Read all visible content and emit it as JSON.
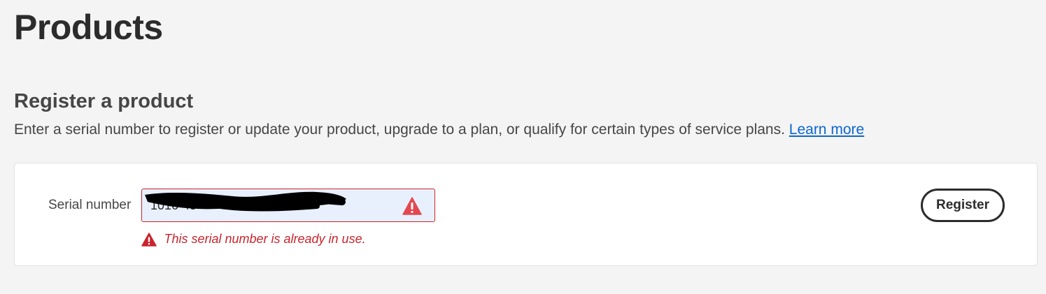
{
  "page": {
    "title": "Products"
  },
  "register_section": {
    "heading": "Register a product",
    "description": "Enter a serial number to register or update your product, upgrade to a plan, or qualify for certain types of service plans.",
    "learn_more_label": "Learn more"
  },
  "form": {
    "serial_label": "Serial number",
    "serial_value": "1016-45",
    "error_message": "This serial number is already in use.",
    "register_label": "Register",
    "field_state": "error",
    "warning_icon": "alert-triangle-icon",
    "redaction": "hand-drawn black scribble covering the serial number"
  },
  "colors": {
    "background": "#f4f4f4",
    "card": "#ffffff",
    "error": "#c9252d",
    "warning_icon": "#e34850",
    "link": "#0d66d0",
    "field_fill": "#e8f0fe",
    "text": "#2c2c2c"
  }
}
